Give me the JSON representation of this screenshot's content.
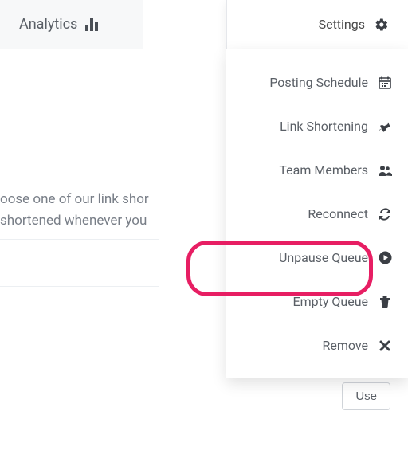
{
  "tabs": {
    "analytics": "Analytics",
    "settings": "Settings"
  },
  "content": {
    "line1": "oose one of our link shor",
    "line2": "shortened whenever you"
  },
  "dropdown": {
    "items": [
      {
        "label": "Posting Schedule"
      },
      {
        "label": "Link Shortening"
      },
      {
        "label": "Team Members"
      },
      {
        "label": "Reconnect"
      },
      {
        "label": "Unpause Queue"
      },
      {
        "label": "Empty Queue"
      },
      {
        "label": "Remove"
      }
    ]
  },
  "buttons": {
    "use": "Use"
  },
  "colors": {
    "highlight": "#e71e63",
    "accent": "#2f7fe6"
  }
}
